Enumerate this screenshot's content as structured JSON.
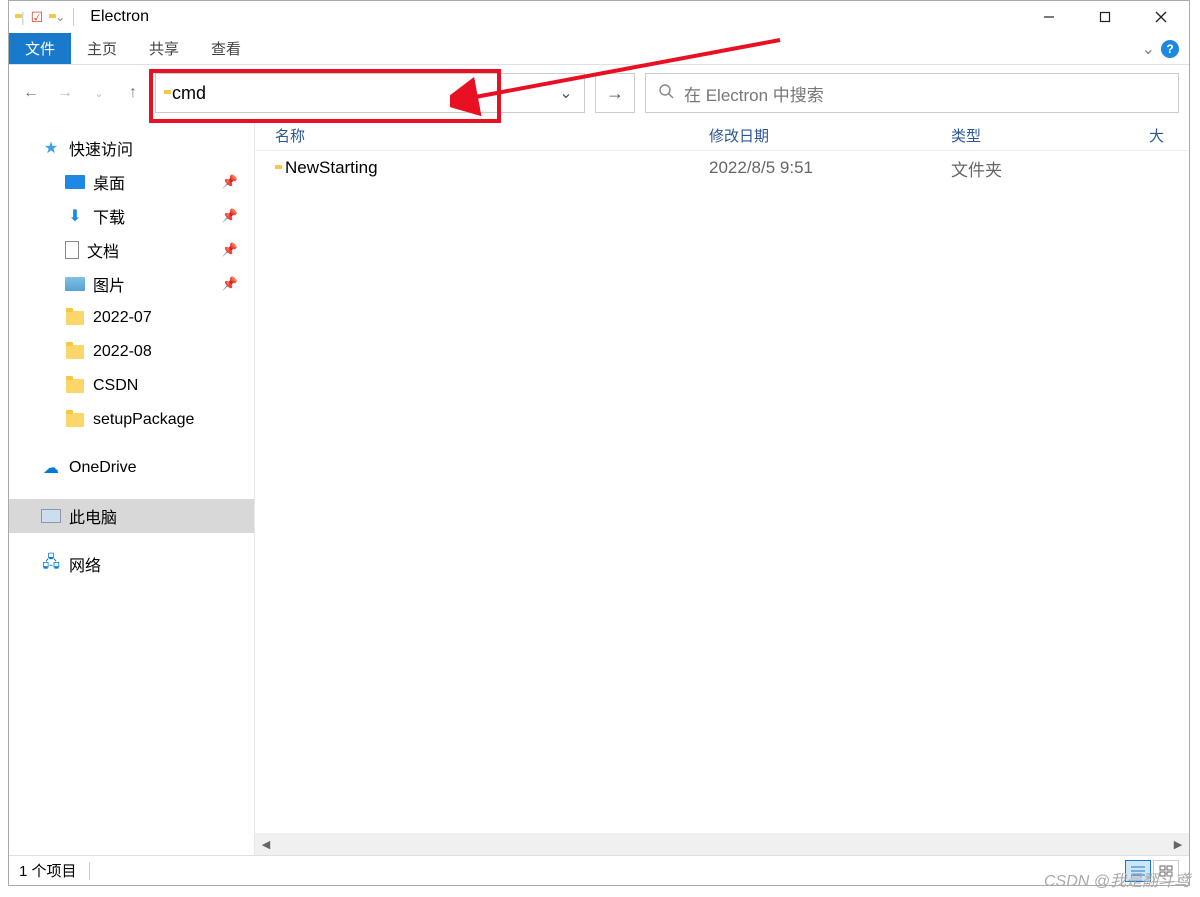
{
  "window": {
    "title": "Electron"
  },
  "ribbon": {
    "tabs": {
      "file": "文件",
      "home": "主页",
      "share": "共享",
      "view": "查看"
    }
  },
  "address": {
    "value": "cmd"
  },
  "search": {
    "placeholder": "在 Electron 中搜索"
  },
  "sidebar": {
    "quick_access": "快速访问",
    "items": [
      {
        "label": "桌面",
        "pinned": true
      },
      {
        "label": "下载",
        "pinned": true
      },
      {
        "label": "文档",
        "pinned": true
      },
      {
        "label": "图片",
        "pinned": true
      },
      {
        "label": "2022-07",
        "pinned": false
      },
      {
        "label": "2022-08",
        "pinned": false
      },
      {
        "label": "CSDN",
        "pinned": false
      },
      {
        "label": "setupPackage",
        "pinned": false
      }
    ],
    "onedrive": "OneDrive",
    "this_pc": "此电脑",
    "network": "网络"
  },
  "columns": {
    "name": "名称",
    "date": "修改日期",
    "type": "类型",
    "size": "大"
  },
  "files": [
    {
      "name": "NewStarting",
      "date": "2022/8/5 9:51",
      "type": "文件夹"
    }
  ],
  "status": {
    "count": "1 个项目"
  },
  "watermark": "CSDN @我是翻斗鸢"
}
